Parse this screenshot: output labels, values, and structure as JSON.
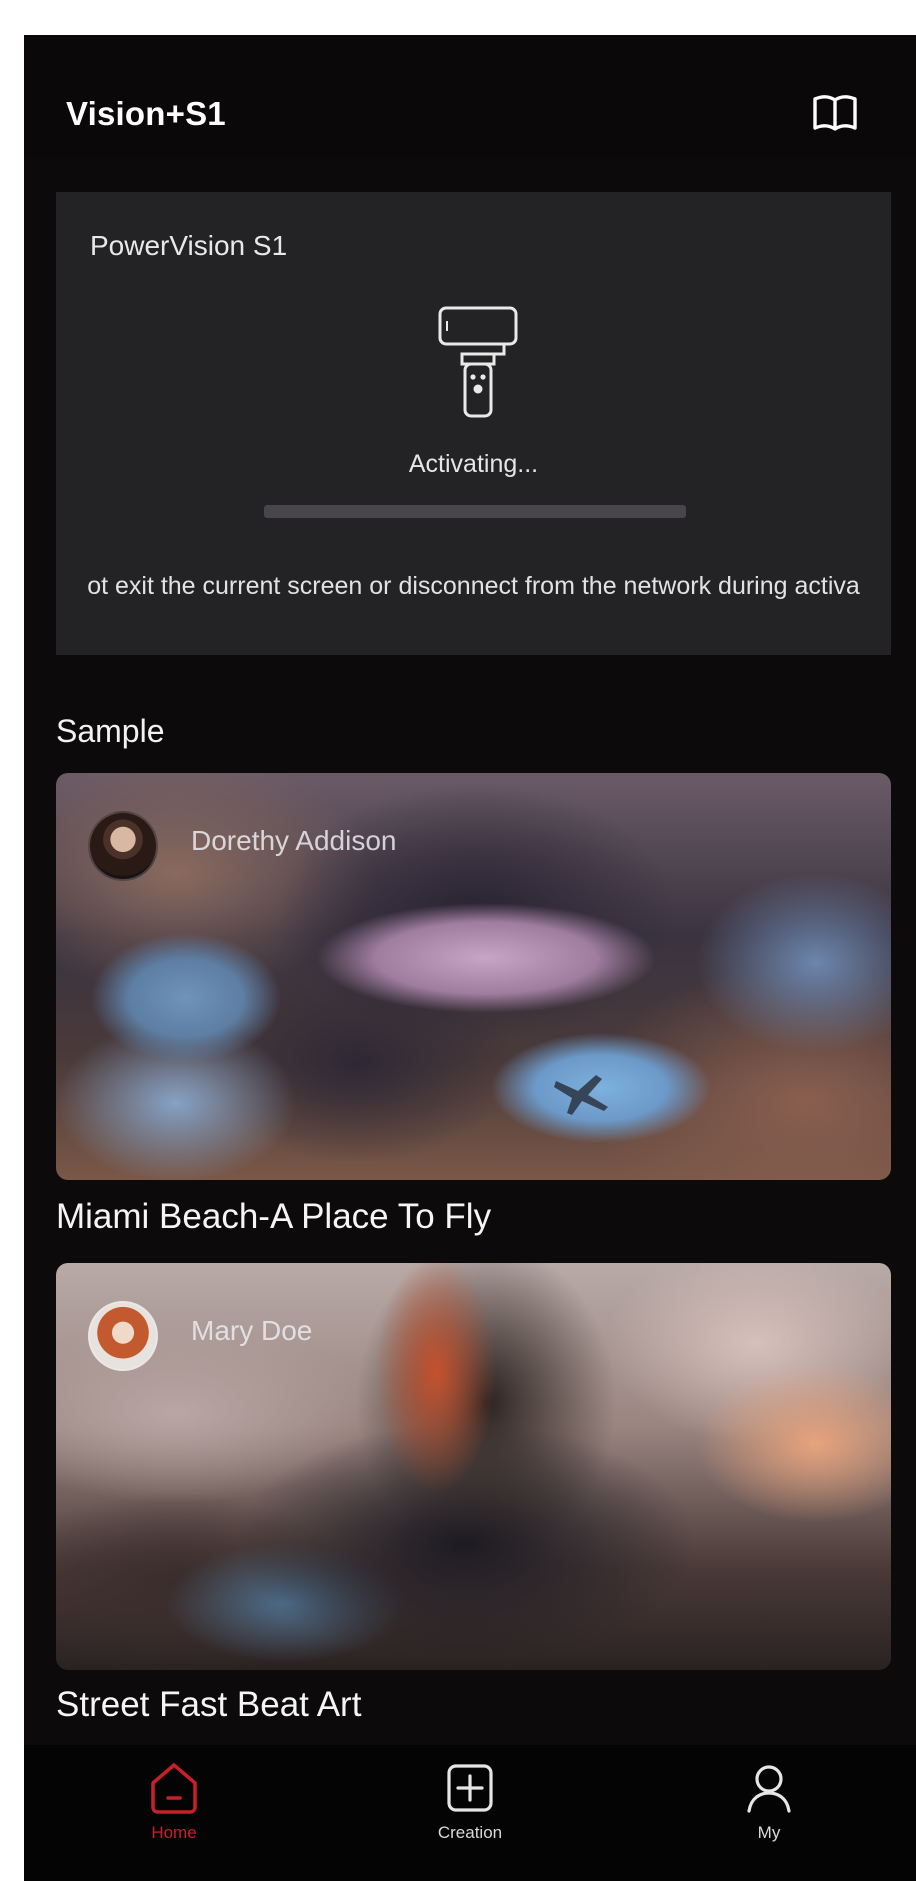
{
  "header": {
    "title": "Vision+S1",
    "guide_icon": "book-icon"
  },
  "device": {
    "name": "PowerVision S1",
    "status": "Activating...",
    "progress": 0,
    "warning": "ot exit the current screen or disconnect from the network during activa"
  },
  "samples": {
    "section_title": "Sample",
    "items": [
      {
        "author": "Dorethy Addison",
        "title": "Miami Beach-A Place To Fly"
      },
      {
        "author": "Mary Doe",
        "title": "Street Fast Beat Art"
      }
    ]
  },
  "tabbar": {
    "tabs": [
      {
        "label": "Home",
        "icon": "home-icon",
        "active": true
      },
      {
        "label": "Creation",
        "icon": "plus-square-icon",
        "active": false
      },
      {
        "label": "My",
        "icon": "user-icon",
        "active": false
      }
    ]
  },
  "colors": {
    "accent": "#c8202a",
    "background": "#0c0a0b",
    "card": "#232224"
  }
}
